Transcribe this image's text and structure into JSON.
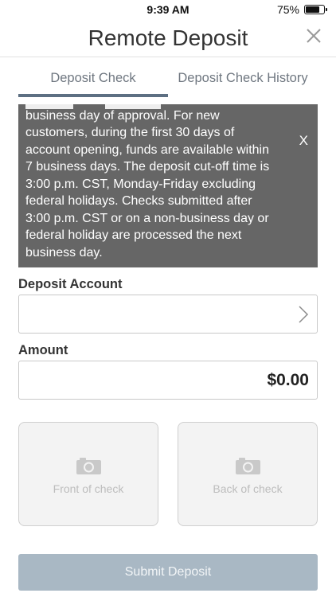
{
  "status_bar": {
    "time": "9:39 AM",
    "battery_percent": "75%",
    "battery_level": 0.75
  },
  "header": {
    "title": "Remote Deposit",
    "close_icon": "close-icon"
  },
  "tabs": [
    {
      "label": "Deposit Check",
      "active": true
    },
    {
      "label": "Deposit Check History",
      "active": false
    }
  ],
  "notice": {
    "lines": [
      "business day of approval. For new",
      "customers, during the first 30 days of",
      "account opening, funds are available within",
      "7 business days. The deposit cut-off time is",
      "3:00 p.m. CST, Monday-Friday excluding",
      "federal holidays. Checks submitted after",
      "3:00 p.m. CST or on a non-business day or",
      "federal holiday are processed the next",
      "business day."
    ],
    "close_label": "X"
  },
  "form": {
    "deposit_account_label": "Deposit Account",
    "deposit_account_value": "",
    "amount_label": "Amount",
    "amount_value": "$0.00"
  },
  "check_images": {
    "front_label": "Front of check",
    "back_label": "Back of check"
  },
  "submit": {
    "label": "Submit Deposit"
  },
  "colors": {
    "tab_indicator": "#5d6f82",
    "notice_bg": "#666666",
    "submit_bg": "#a9b8c4"
  }
}
